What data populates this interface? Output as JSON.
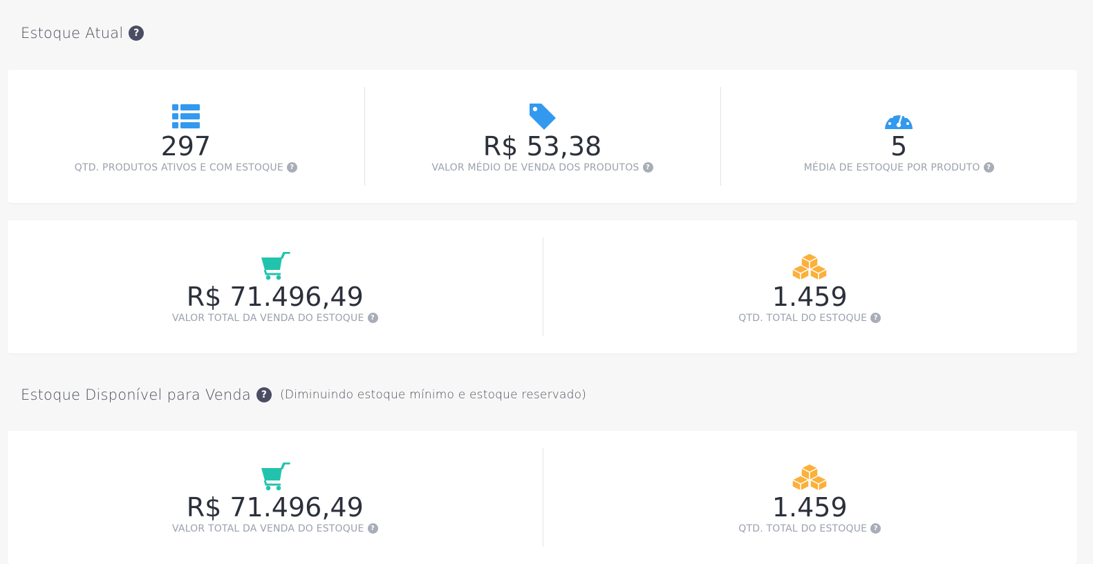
{
  "section1": {
    "title": "Estoque Atual",
    "help": "?",
    "row1": [
      {
        "icon": "list-icon",
        "value": "297",
        "label": "QTD. PRODUTOS ATIVOS E COM ESTOQUE"
      },
      {
        "icon": "tag-icon",
        "value": "R$ 53,38",
        "label": "VALOR MÉDIO DE VENDA DOS PRODUTOS"
      },
      {
        "icon": "speedometer-icon",
        "value": "5",
        "label": "MÉDIA DE ESTOQUE POR PRODUTO"
      }
    ],
    "row2": [
      {
        "icon": "cart-icon",
        "value": "R$ 71.496,49",
        "label": "VALOR TOTAL DA VENDA DO ESTOQUE"
      },
      {
        "icon": "boxes-icon",
        "value": "1.459",
        "label": "QTD. TOTAL DO ESTOQUE"
      }
    ]
  },
  "section2": {
    "title": "Estoque Disponível para Venda",
    "help": "?",
    "subtitle": "(Diminuindo estoque mínimo e estoque reservado)",
    "row1": [
      {
        "icon": "cart-icon",
        "value": "R$ 71.496,49",
        "label": "VALOR TOTAL DA VENDA DO ESTOQUE"
      },
      {
        "icon": "boxes-icon",
        "value": "1.459",
        "label": "QTD. TOTAL DO ESTOQUE"
      }
    ]
  },
  "colors": {
    "blue": "#3399ee",
    "teal": "#22c3ad",
    "orange": "#fbb03b"
  }
}
